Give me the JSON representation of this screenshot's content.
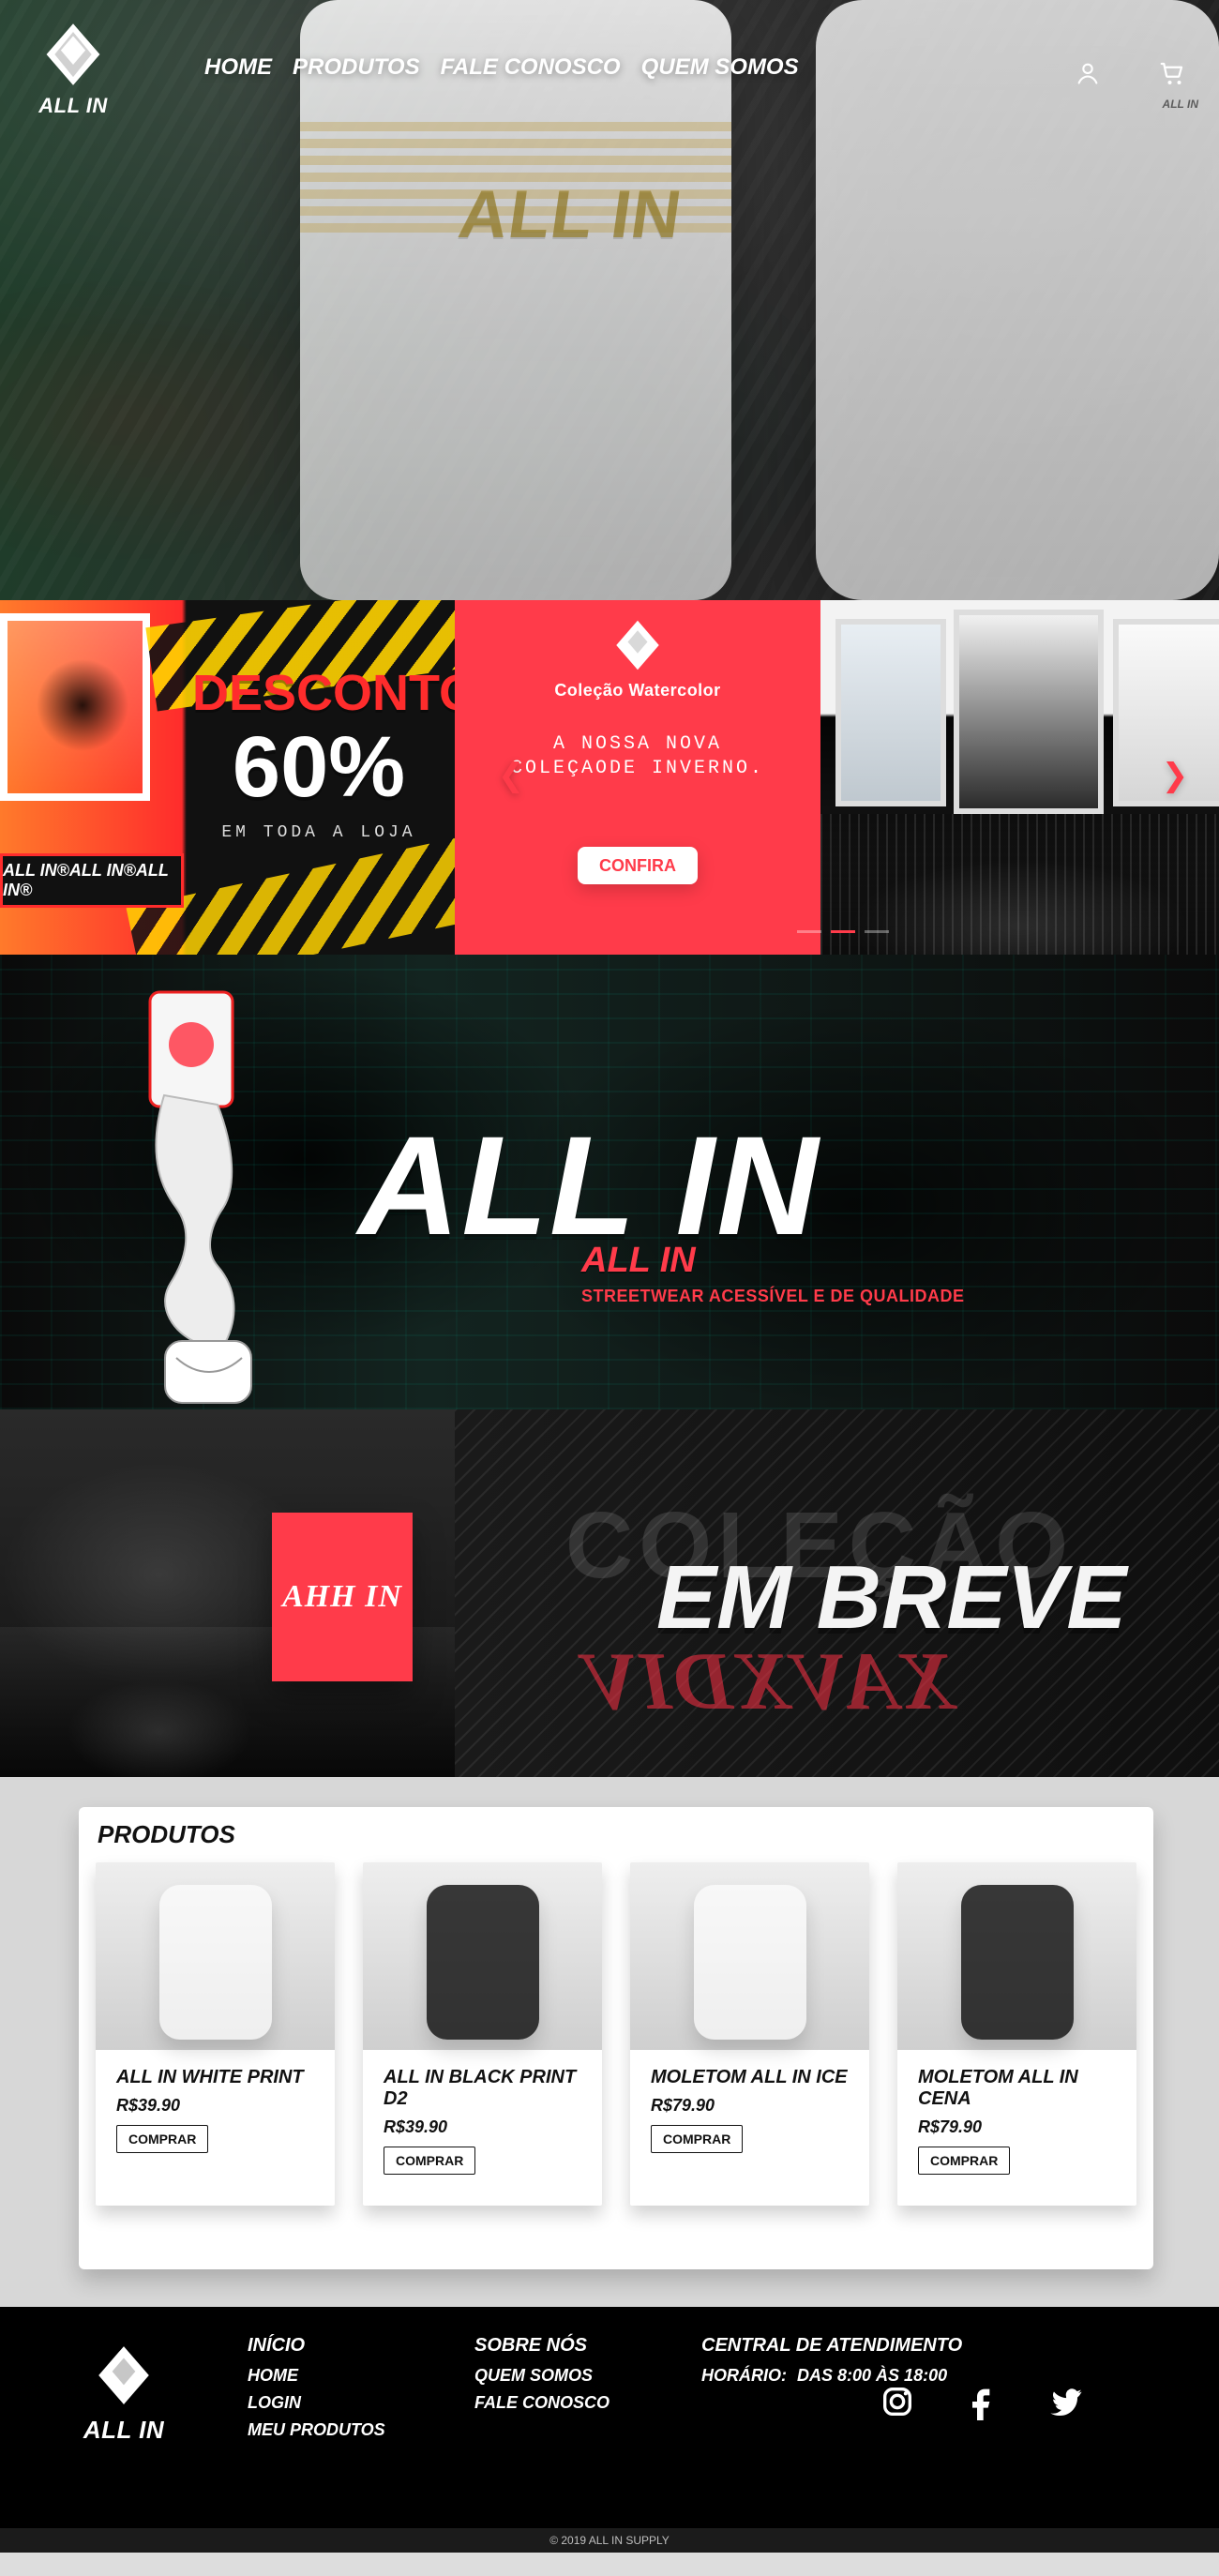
{
  "header": {
    "brand_name": "ALL IN",
    "nav": [
      "HOME",
      "PRODUTOS",
      "FALE CONOSCO",
      "QUEM SOMOS"
    ],
    "mini_brand": "ALL IN",
    "icons": {
      "account": "user-icon",
      "cart": "cart-icon"
    }
  },
  "hero": {
    "jersey_text": "ALL IN"
  },
  "promo": {
    "left": {
      "discount_word": "DESCONTO",
      "discount_value": "60%",
      "discount_note": "EM TODA A LOJA",
      "strip_text": "ALL IN®ALL IN®ALL IN®"
    },
    "center": {
      "collection_title": "Coleção Watercolor",
      "subtitle": "A NOSSA NOVA\nCOLEÇAODE INVERNO.",
      "cta": "CONFIRA"
    },
    "arrows": {
      "left": "chevron-left-icon",
      "right": "chevron-right-icon"
    }
  },
  "brand_hero": {
    "title": "ALL IN",
    "small": "ALL IN",
    "tagline": "STREETWEAR ACESSÍVEL E DE QUALIDADE"
  },
  "soon": {
    "badge": "AHH IN",
    "bg_word": "COLEÇÃO",
    "headline": "EM BREVE",
    "mirror_text": "XAVXDIV"
  },
  "products": {
    "title": "PRODUTOS",
    "items": [
      {
        "name": "ALL IN WHITE PRINT",
        "price": "R$39.90",
        "buy": "COMPRAR",
        "theme": "light"
      },
      {
        "name": "ALL IN BLACK PRINT D2",
        "price": "R$39.90",
        "buy": "COMPRAR",
        "theme": "dark"
      },
      {
        "name": "MOLETOM ALL IN ICE",
        "price": "R$79.90",
        "buy": "COMPRAR",
        "theme": "light"
      },
      {
        "name": "MOLETOM ALL IN CENA",
        "price": "R$79.90",
        "buy": "COMPRAR",
        "theme": "dark"
      }
    ]
  },
  "footer": {
    "brand_name": "ALL IN",
    "col1": {
      "title": "INÍCIO",
      "links": [
        "HOME",
        "LOGIN",
        "MEU PRODUTOS"
      ]
    },
    "col2": {
      "title": "SOBRE NÓS",
      "links": [
        "QUEM SOMOS",
        "FALE CONOSCO"
      ]
    },
    "col3": {
      "title": "CENTRAL DE ATENDIMENTO",
      "hours_label": "HORÁRIO:",
      "hours_value": "DAS 8:00 ÀS 18:00"
    },
    "socials": [
      "instagram-icon",
      "facebook-icon",
      "twitter-icon"
    ],
    "copyright": "© 2019 ALL IN SUPPLY"
  },
  "colors": {
    "accent": "#ff3b4a",
    "black": "#000000"
  }
}
